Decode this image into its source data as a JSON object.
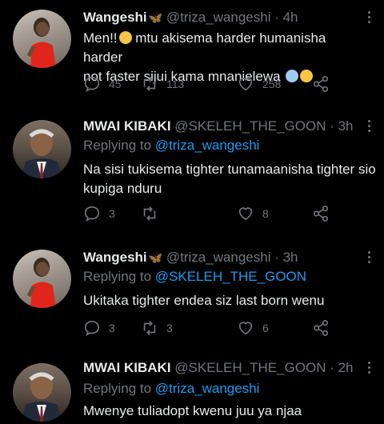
{
  "tweets": [
    {
      "name": "Wangeshi",
      "handle": "@triza_wangeshi",
      "time": "· 4h",
      "replying_label": "",
      "replying_to": "",
      "text_line1": "Men!!",
      "text_line1_rest": " mtu akisema harder humanisha harder",
      "text_line2": "not faster sijui kama mnanielewa ",
      "replies": "45",
      "retweets": "113",
      "likes": "258"
    },
    {
      "name": "MWAI KIBAKI",
      "handle": "@SKELEH_THE_GOON",
      "time": "· 3h",
      "replying_label": "Replying to ",
      "replying_to": "@triza_wangeshi",
      "text_line1": "Na sisi tukisema tighter tunamaanisha tighter sio",
      "text_line2": "kupiga nduru",
      "replies": "3",
      "retweets": "",
      "likes": "8"
    },
    {
      "name": "Wangeshi",
      "handle": "@triza_wangeshi",
      "time": "· 3h",
      "replying_label": "Replying to ",
      "replying_to": "@SKELEH_THE_GOON",
      "text_line1": "Ukitaka tighter endea siz last born wenu",
      "text_line2": "",
      "replies": "3",
      "retweets": "3",
      "likes": "6"
    },
    {
      "name": "MWAI KIBAKI",
      "handle": "@SKELEH_THE_GOON",
      "time": "· 2h",
      "replying_label": "Replying to ",
      "replying_to": "@triza_wangeshi",
      "text_line1": "Mwenye tuliadopt kwenu juu ya njaa",
      "text_line2": "",
      "replies": "",
      "retweets": "",
      "likes": ""
    }
  ],
  "icons": {
    "reply": "reply-icon",
    "retweet": "retweet-icon",
    "like": "heart-icon",
    "share": "share-icon",
    "more": "more-icon"
  },
  "colors": {
    "background": "#000000",
    "text": "#e7e9ea",
    "muted": "#71767b",
    "link": "#1d9bf0"
  }
}
